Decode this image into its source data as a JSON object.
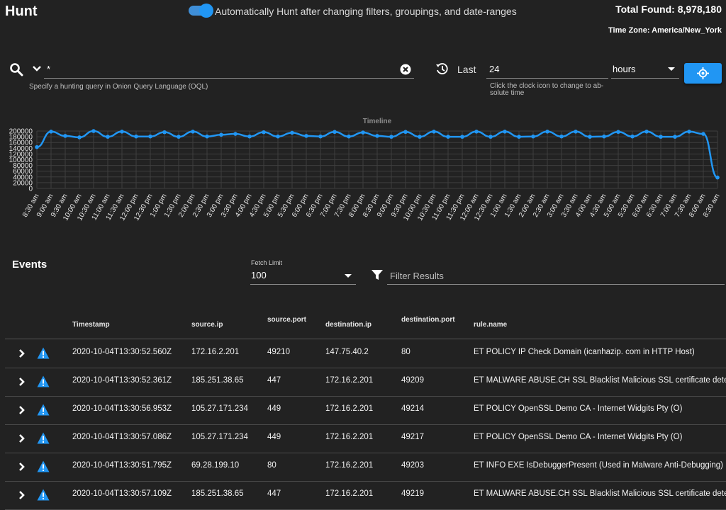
{
  "header": {
    "title": "Hunt",
    "auto_hunt_label": "Automatically Hunt after changing filters, groupings, and date-ranges",
    "auto_hunt_enabled": true,
    "total_found": "Total Found: 8,978,180",
    "time_zone": "Time Zone: America/New_York"
  },
  "query": {
    "value": "*",
    "hint": "Specify a hunting query in Onion Query Language (OQL)"
  },
  "date_range": {
    "last_label": "Last",
    "amount": "24",
    "unit": "hours",
    "hint": "Click the clock icon to change to ab- solute time"
  },
  "chart_data": {
    "type": "line",
    "title": "Timeline",
    "ylim": [
      0,
      200000
    ],
    "yticks": [
      "200000",
      "180000",
      "160000",
      "140000",
      "120000",
      "100000",
      "80000",
      "60000",
      "40000",
      "20000",
      "0"
    ],
    "grid": true,
    "color": "#2196f3",
    "x": [
      "8:30 am",
      "9:00 am",
      "9:30 am",
      "10:00 am",
      "10:30 am",
      "11:00 am",
      "11:30 am",
      "12:00 pm",
      "12:30 pm",
      "1:00 pm",
      "1:30 pm",
      "2:00 pm",
      "2:30 pm",
      "3:00 pm",
      "3:30 pm",
      "4:00 pm",
      "4:30 pm",
      "5:00 pm",
      "5:30 pm",
      "6:00 pm",
      "6:30 pm",
      "7:00 pm",
      "7:30 pm",
      "8:00 pm",
      "8:30 pm",
      "9:00 pm",
      "9:30 pm",
      "10:00 pm",
      "10:30 pm",
      "11:00 pm",
      "11:30 pm",
      "12:00 am",
      "12:30 am",
      "1:00 am",
      "1:30 am",
      "2:00 am",
      "2:30 am",
      "3:00 am",
      "3:30 am",
      "4:00 am",
      "4:30 am",
      "5:00 am",
      "5:30 am",
      "6:00 am",
      "6:30 am",
      "7:00 am",
      "7:30 am",
      "8:00 am",
      "8:30 am"
    ],
    "values": [
      144000,
      198000,
      183000,
      178000,
      200000,
      180000,
      198000,
      181000,
      181000,
      196000,
      180000,
      198000,
      181000,
      187000,
      190000,
      181000,
      196000,
      181000,
      194000,
      183000,
      181000,
      197000,
      181000,
      195000,
      183000,
      180000,
      197000,
      180000,
      198000,
      180000,
      180000,
      198000,
      180000,
      198000,
      180000,
      181000,
      198000,
      181000,
      198000,
      180000,
      181000,
      197000,
      181000,
      198000,
      180000,
      180000,
      198000,
      190000,
      38000
    ]
  },
  "events": {
    "title": "Events",
    "fetch_limit_label": "Fetch Limit",
    "fetch_limit": "100",
    "filter_placeholder": "Filter Results",
    "columns": [
      "Timestamp",
      "source.ip",
      "source.port",
      "destination.ip",
      "destination.port",
      "rule.name"
    ],
    "rows": [
      [
        "2020-10-04T13:30:52.560Z",
        "172.16.2.201",
        "49210",
        "147.75.40.2",
        "80",
        "ET POLICY IP Check Domain (icanhazip. com in HTTP Host)"
      ],
      [
        "2020-10-04T13:30:52.361Z",
        "185.251.38.65",
        "447",
        "172.16.2.201",
        "49209",
        "ET MALWARE ABUSE.CH SSL Blacklist Malicious SSL certificate detected"
      ],
      [
        "2020-10-04T13:30:56.953Z",
        "105.27.171.234",
        "449",
        "172.16.2.201",
        "49214",
        "ET POLICY OpenSSL Demo CA - Internet Widgits Pty (O)"
      ],
      [
        "2020-10-04T13:30:57.086Z",
        "105.27.171.234",
        "449",
        "172.16.2.201",
        "49217",
        "ET POLICY OpenSSL Demo CA - Internet Widgits Pty (O)"
      ],
      [
        "2020-10-04T13:30:51.795Z",
        "69.28.199.10",
        "80",
        "172.16.2.201",
        "49203",
        "ET INFO EXE IsDebuggerPresent (Used in Malware Anti-Debugging)"
      ],
      [
        "2020-10-04T13:30:57.109Z",
        "185.251.38.65",
        "447",
        "172.16.2.201",
        "49219",
        "ET MALWARE ABUSE.CH SSL Blacklist Malicious SSL certificate detected"
      ]
    ]
  }
}
